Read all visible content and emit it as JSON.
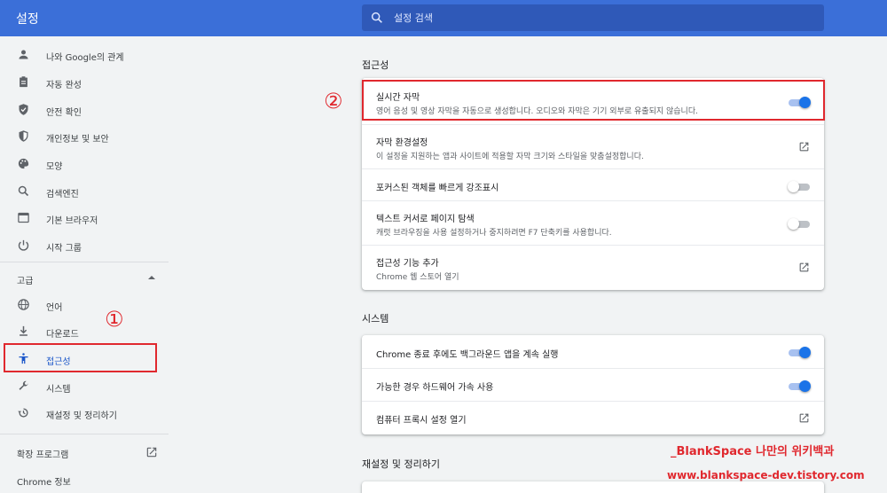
{
  "header": {
    "title": "설정",
    "search_placeholder": "설정 검색"
  },
  "sidebar": {
    "items": [
      {
        "label": "나와 Google의 관계",
        "icon": "person-icon"
      },
      {
        "label": "자동 완성",
        "icon": "clipboard-icon"
      },
      {
        "label": "안전 확인",
        "icon": "shield-check-icon"
      },
      {
        "label": "개인정보 및 보안",
        "icon": "shield-icon"
      },
      {
        "label": "모양",
        "icon": "palette-icon"
      },
      {
        "label": "검색엔진",
        "icon": "search-icon"
      },
      {
        "label": "기본 브라우저",
        "icon": "browser-icon"
      },
      {
        "label": "시작 그룹",
        "icon": "power-icon"
      }
    ],
    "advanced_label": "고급",
    "advanced_items": [
      {
        "label": "언어",
        "icon": "globe-icon"
      },
      {
        "label": "다운로드",
        "icon": "download-icon"
      },
      {
        "label": "접근성",
        "icon": "accessibility-icon"
      },
      {
        "label": "시스템",
        "icon": "wrench-icon"
      },
      {
        "label": "재설정 및 정리하기",
        "icon": "history-icon"
      }
    ],
    "extensions_label": "확장 프로그램",
    "about_label": "Chrome 정보"
  },
  "annotations": {
    "marker1": "①",
    "marker2": "②",
    "color": "#e0282e"
  },
  "accessibility": {
    "title": "접근성",
    "rows": [
      {
        "title": "실시간 자막",
        "subtitle": "영어 음성 및 영상 자막을 자동으로 생성합니다. 오디오와 자막은 기기 외부로 유출되지 않습니다.",
        "control": "toggle",
        "on": true
      },
      {
        "title": "자막 환경설정",
        "subtitle": "이 설정을 지원하는 앱과 사이트에 적용할 자막 크기와 스타일을 맞춤설정합니다.",
        "control": "link"
      },
      {
        "title": "포커스된 객체를 빠르게 강조표시",
        "subtitle": "",
        "control": "toggle",
        "on": false
      },
      {
        "title": "텍스트 커서로 페이지 탐색",
        "subtitle": "캐럿 브라우징을 사용 설정하거나 중지하려면 F7 단축키를 사용합니다.",
        "control": "toggle",
        "on": false
      },
      {
        "title": "접근성 기능 추가",
        "subtitle": "Chrome 웹 스토어 열기",
        "control": "link"
      }
    ]
  },
  "system": {
    "title": "시스템",
    "rows": [
      {
        "title": "Chrome 종료 후에도 백그라운드 앱을 계속 실행",
        "control": "toggle",
        "on": true
      },
      {
        "title": "가능한 경우 하드웨어 가속 사용",
        "control": "toggle",
        "on": true
      },
      {
        "title": "컴퓨터 프록시 설정 열기",
        "control": "link"
      }
    ]
  },
  "reset": {
    "title": "재설정 및 정리하기"
  },
  "watermark": {
    "line1": "_BlankSpace 나만의 위키백과",
    "line2": "www.blankspace-dev.tistory.com"
  },
  "colors": {
    "header": "#3b6fd8",
    "accent": "#1a73e8",
    "annotation": "#e0282e"
  }
}
